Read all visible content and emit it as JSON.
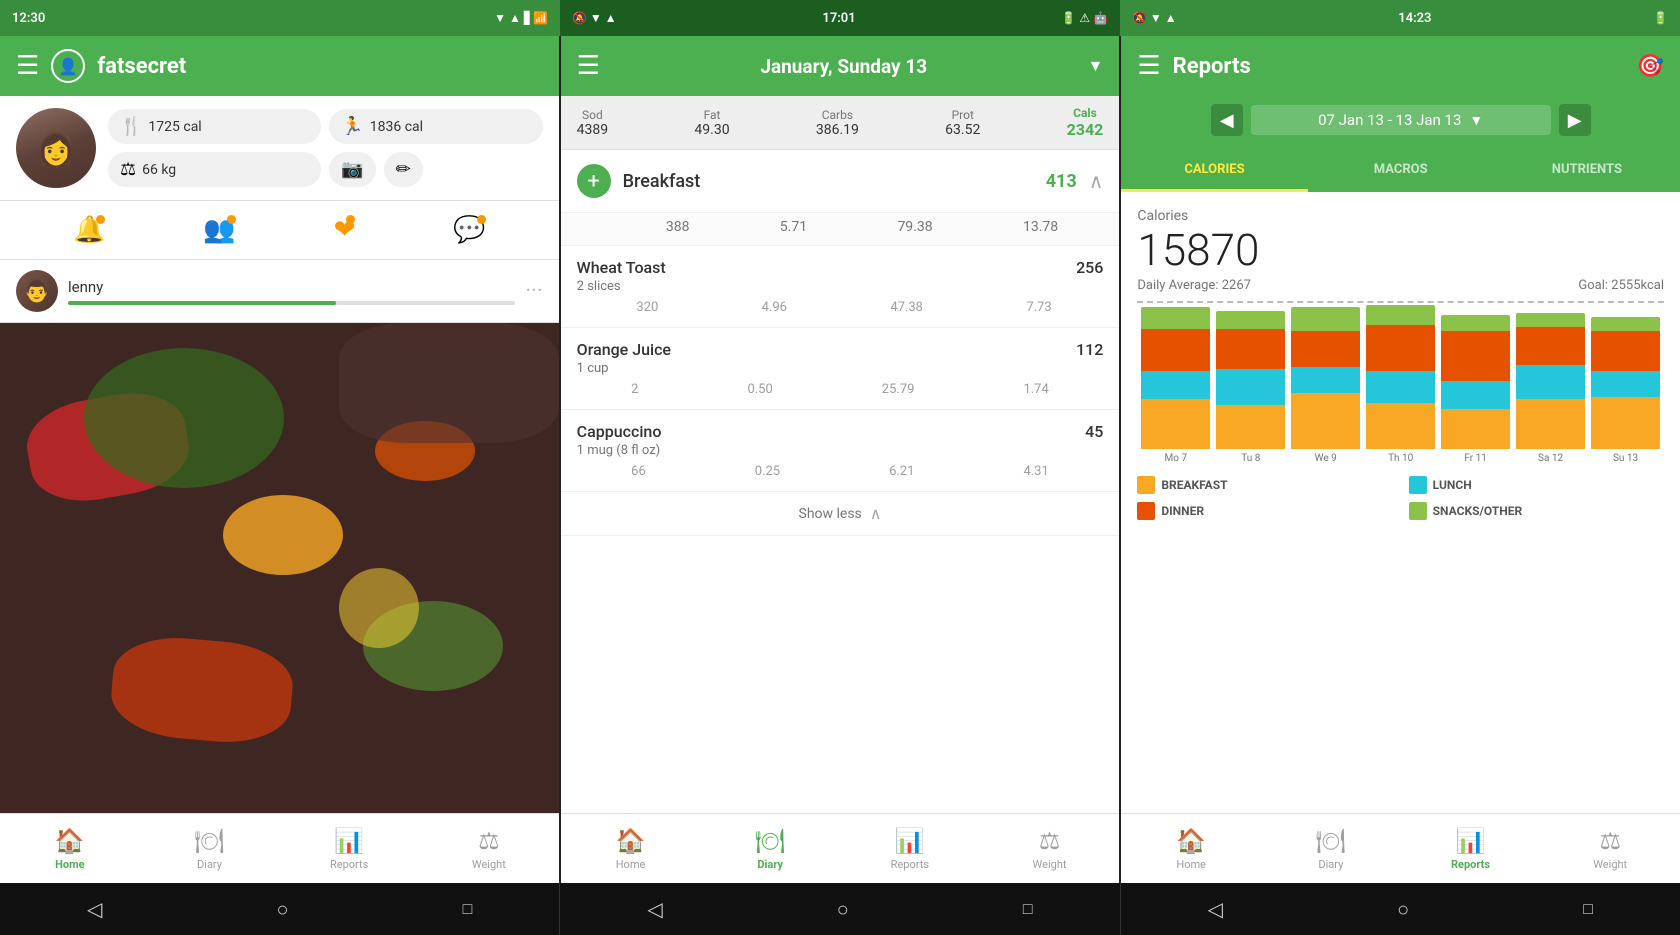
{
  "screens": {
    "screen1": {
      "statusBar": {
        "left": "12:30",
        "icons": "▼ ▲ ▋ 📶"
      },
      "appBar": {
        "menu": "☰",
        "logo": "👤",
        "title": "fatsecret"
      },
      "profile": {
        "stats": [
          {
            "icon": "🍴",
            "value": "1725 cal"
          },
          {
            "icon": "🏃",
            "value": "1836 cal"
          },
          {
            "icon": "⚖",
            "value": "66 kg"
          },
          {
            "icon": "📷",
            "value": ""
          },
          {
            "icon": "✏",
            "value": ""
          }
        ]
      },
      "socialIcons": [
        "🔔",
        "👤",
        "❤",
        "💬"
      ],
      "friend": {
        "name": "lenny",
        "progressWidth": "60%"
      },
      "nav": {
        "items": [
          {
            "icon": "🏠",
            "label": "Home",
            "active": true
          },
          {
            "icon": "🍽",
            "label": "Diary",
            "active": false
          },
          {
            "icon": "📊",
            "label": "Reports",
            "active": false
          },
          {
            "icon": "⚖",
            "label": "Weight",
            "active": false
          }
        ]
      }
    },
    "screen2": {
      "statusBar": {
        "time": "17:01"
      },
      "appBar": {
        "menu": "☰",
        "date": "January, Sunday 13",
        "dropdown": "▼"
      },
      "macros": {
        "headers": [
          "Sod",
          "Fat",
          "Carbs",
          "Prot",
          "Cals"
        ],
        "values": [
          "4389",
          "49.30",
          "386.19",
          "63.52",
          "2342"
        ]
      },
      "meals": [
        {
          "name": "Breakfast",
          "calories": "413",
          "totals": [
            "388",
            "5.71",
            "79.38",
            "13.78"
          ],
          "items": [
            {
              "name": "Wheat Toast",
              "desc": "2 slices",
              "calories": "256",
              "macros": [
                "320",
                "4.96",
                "47.38",
                "7.73"
              ]
            },
            {
              "name": "Orange Juice",
              "desc": "1 cup",
              "calories": "112",
              "macros": [
                "2",
                "0.50",
                "25.79",
                "1.74"
              ]
            },
            {
              "name": "Cappuccino",
              "desc": "1 mug (8 fl oz)",
              "calories": "45",
              "macros": [
                "66",
                "0.25",
                "6.21",
                "4.31"
              ]
            }
          ]
        }
      ],
      "showLess": "Show less",
      "nav": {
        "items": [
          {
            "icon": "🏠",
            "label": "Home",
            "active": false
          },
          {
            "icon": "🍽",
            "label": "Diary",
            "active": true
          },
          {
            "icon": "📊",
            "label": "Reports",
            "active": false
          },
          {
            "icon": "⚖",
            "label": "Weight",
            "active": false
          }
        ]
      }
    },
    "screen3": {
      "statusBar": {
        "time": "14:23"
      },
      "appBar": {
        "title": "Reports",
        "targetIcon": "🎯"
      },
      "dateRange": {
        "prev": "◀",
        "label": "07 Jan 13 - 13 Jan 13",
        "next": "▶"
      },
      "tabs": [
        {
          "label": "CALORIES",
          "active": true
        },
        {
          "label": "MACROS",
          "active": false
        },
        {
          "label": "NUTRIENTS",
          "active": false
        }
      ],
      "calories": {
        "label": "Calories",
        "total": "15870",
        "dailyAvg": "Daily Average: 2267",
        "goal": "Goal: 2555kcal"
      },
      "chart": {
        "days": [
          "Mo 7",
          "Tu 8",
          "We 9",
          "Th 10",
          "Fr 11",
          "Sa 12",
          "Su 13"
        ],
        "bars": [
          {
            "breakfast": 35,
            "lunch": 20,
            "dinner": 30,
            "snacks": 15
          },
          {
            "breakfast": 30,
            "lunch": 25,
            "dinner": 28,
            "snacks": 12
          },
          {
            "breakfast": 40,
            "lunch": 18,
            "dinner": 25,
            "snacks": 17
          },
          {
            "breakfast": 32,
            "lunch": 22,
            "dinner": 32,
            "snacks": 14
          },
          {
            "breakfast": 28,
            "lunch": 20,
            "dinner": 35,
            "snacks": 12
          },
          {
            "breakfast": 35,
            "lunch": 24,
            "dinner": 26,
            "snacks": 10
          },
          {
            "breakfast": 38,
            "lunch": 19,
            "dinner": 28,
            "snacks": 10
          }
        ]
      },
      "legend": [
        {
          "label": "BREAKFAST",
          "color": "#f9a825"
        },
        {
          "label": "LUNCH",
          "color": "#26c6da"
        },
        {
          "label": "DINNER",
          "color": "#e65100"
        },
        {
          "label": "SNACKS/OTHER",
          "color": "#8bc34a"
        }
      ],
      "nav": {
        "items": [
          {
            "icon": "🏠",
            "label": "Home",
            "active": false
          },
          {
            "icon": "🍽",
            "label": "Diary",
            "active": false
          },
          {
            "icon": "📊",
            "label": "Reports",
            "active": true
          },
          {
            "icon": "⚖",
            "label": "Weight",
            "active": false
          }
        ]
      }
    }
  },
  "android": {
    "back": "◁",
    "home": "○",
    "recent": "□"
  }
}
